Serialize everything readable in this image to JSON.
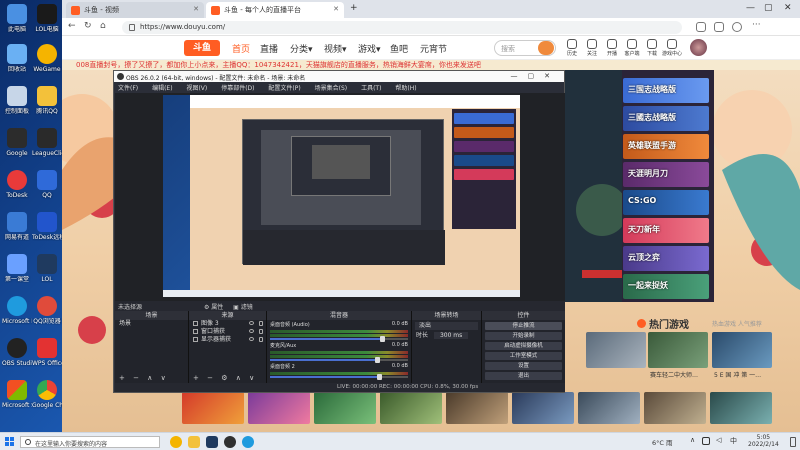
{
  "desktop": {
    "icons": [
      {
        "label": "此电脑",
        "color": "#4a90e2"
      },
      {
        "label": "LOL电脑",
        "color": "#1a1a1a"
      },
      {
        "label": "回收站",
        "color": "#6ab0f3"
      },
      {
        "label": "WeGame",
        "color": "#f5b400"
      },
      {
        "label": "控制面板",
        "color": "#c7d6e8"
      },
      {
        "label": "腾讯QQ",
        "color": "#111111"
      },
      {
        "label": "Google",
        "color": "#2c2c2c"
      },
      {
        "label": "LeagueClient",
        "color": "#2a2a2a"
      },
      {
        "label": "ToDesk",
        "color": "#e83a3a"
      },
      {
        "label": "QQ",
        "color": "#2f6ad9"
      },
      {
        "label": "网易有道",
        "color": "#3a7bd5"
      },
      {
        "label": "ToDesk远程",
        "color": "#2255cc"
      },
      {
        "label": "第一课堂",
        "color": "#6aa0ff"
      },
      {
        "label": "LOL",
        "color": "#1f3a5f"
      },
      {
        "label": "Microsoft Edge",
        "color": "#1f9bde"
      },
      {
        "label": "QQ浏览器",
        "color": "#e04b3b"
      },
      {
        "label": "OBS Studio",
        "color": "#222222"
      },
      {
        "label": "WPS Office",
        "color": "#e33232"
      },
      {
        "label": "Microsoft Store",
        "color": "#2b7bd8"
      },
      {
        "label": "Google Chrome",
        "color": "#f4b400"
      }
    ]
  },
  "browser": {
    "tabs": [
      {
        "title": "斗鱼 - 视频",
        "active": false
      },
      {
        "title": "斗鱼 - 每个人的直播平台",
        "active": true
      }
    ],
    "new_tab": "+",
    "url": "https://www.douyu.com/",
    "win_controls": [
      "—",
      "▢",
      "✕"
    ]
  },
  "douyu": {
    "logo": "斗鱼",
    "nav": [
      "首页",
      "直播",
      "分类▾",
      "视频▾",
      "游戏▾",
      "鱼吧",
      "元宵节"
    ],
    "search_placeholder": "搜索",
    "icons": [
      "历史",
      "关注",
      "开播",
      "客户端",
      "下载",
      "游戏中心"
    ],
    "marquee": "008直播封号，撩了又撩了，都加你上小点来，主播QQ：1047342421，天猫旗舰店的直播服务，热销海鲜大宴席，你也来发送吧",
    "game_thumbs": [
      "三国志战略版",
      "三國志战略版",
      "英雄联盟手游",
      "天涯明月刀",
      "CS:GO",
      "天刀新年",
      "云顶之弈",
      "一起来捉妖"
    ],
    "hot_title": "热门游戏",
    "hot_sub": "热血游戏 人气推荐",
    "hot_captions": [
      "赛车轻二中大师…",
      "5 E 国 冲 第 一…"
    ]
  },
  "obs": {
    "title": "OBS 26.0.2 (64-bit, windows) - 配置文件: 未命名 - 场景: 未命名",
    "menu": [
      "文件(F)",
      "编辑(E)",
      "视图(V)",
      "停靠部件(D)",
      "配置文件(P)",
      "场景集合(S)",
      "工具(T)",
      "帮助(H)"
    ],
    "src_bar": [
      "未选择源",
      "⚙ 属性",
      "▣ 滤镜"
    ],
    "scenes_title": "场景",
    "scenes": [
      "场景"
    ],
    "sources_title": "来源",
    "sources": [
      "图像 3",
      "窗口捕获",
      "显示器捕获"
    ],
    "mixer_title": "混音器",
    "mixer": [
      {
        "name": "桌面音频 (Audio)",
        "db": "0.0 dB",
        "level": 0.82
      },
      {
        "name": "麦克风/Aux",
        "db": "0.0 dB",
        "level": 0.78
      },
      {
        "name": "桌面音频 2",
        "db": "0.0 dB",
        "level": 0.8
      }
    ],
    "transition_title": "场景转场",
    "transition_type": "淡出",
    "duration_label": "时长",
    "duration": "300 ms",
    "controls_title": "控件",
    "controls": [
      "停止推流",
      "开始录制",
      "启动虚拟摄像机",
      "工作室模式",
      "设置",
      "退出"
    ],
    "status": "LIVE: 00:00:00   REC: 00:00:00   CPU: 0.8%, 30.00 fps",
    "dock_foot": [
      "+",
      "−",
      "⚙",
      "∧",
      "∨"
    ]
  },
  "taskbar": {
    "search_placeholder": "在这里输入你要搜索的内容",
    "weather": "6°C 雨",
    "time": "5:05",
    "date": "2022/2/14",
    "apps": [
      {
        "name": "Google Chrome",
        "color": "#f4b400"
      },
      {
        "name": "文件资源管理器",
        "color": "#f3c13a"
      },
      {
        "name": "LOL",
        "color": "#1f3a5f"
      },
      {
        "name": "OBS",
        "color": "#303030"
      },
      {
        "name": "Edge",
        "color": "#1f9bde"
      }
    ]
  }
}
